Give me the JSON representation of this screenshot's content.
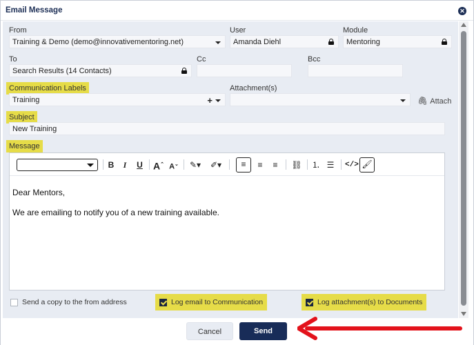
{
  "dialog": {
    "title": "Email Message",
    "close_icon": "close-icon"
  },
  "form": {
    "from": {
      "label": "From",
      "value": "Training & Demo (demo@innovativementoring.net)"
    },
    "user": {
      "label": "User",
      "value": "Amanda Diehl"
    },
    "module": {
      "label": "Module",
      "value": "Mentoring"
    },
    "to": {
      "label": "To",
      "value": "Search Results (14 Contacts)"
    },
    "cc": {
      "label": "Cc",
      "value": ""
    },
    "bcc": {
      "label": "Bcc",
      "value": ""
    },
    "labels": {
      "label": "Communication Labels",
      "value": "Training",
      "add": "+"
    },
    "attachments": {
      "label": "Attachment(s)",
      "value": "",
      "attach_link": "Attach"
    },
    "subject": {
      "label": "Subject",
      "value": "New Training"
    },
    "message": {
      "label": "Message"
    }
  },
  "toolbar": {
    "bold": "B",
    "italic": "I",
    "underline": "U",
    "font_size_up": "A",
    "font_size_down": "A",
    "items": [
      "bold",
      "italic",
      "underline",
      "font-size-up",
      "font-size-down",
      "text-color",
      "highlight",
      "align-left",
      "align-center",
      "align-right",
      "link",
      "ordered-list",
      "bullet-list",
      "code-view",
      "clear-format"
    ]
  },
  "editor": {
    "line1": "Dear Mentors,",
    "line2": "We are emailing to notify you of a new training available."
  },
  "options": {
    "copy_to_from": {
      "label": "Send a copy to the from address",
      "checked": false
    },
    "log_email": {
      "label": "Log email to Communication",
      "checked": true
    },
    "log_attachments": {
      "label": "Log attachment(s) to Documents",
      "checked": true
    }
  },
  "footer": {
    "cancel_label": "Cancel",
    "send_label": "Send"
  },
  "colors": {
    "highlight": "#e6dc48",
    "primary": "#182c58",
    "annotation_arrow": "#e3121b"
  }
}
